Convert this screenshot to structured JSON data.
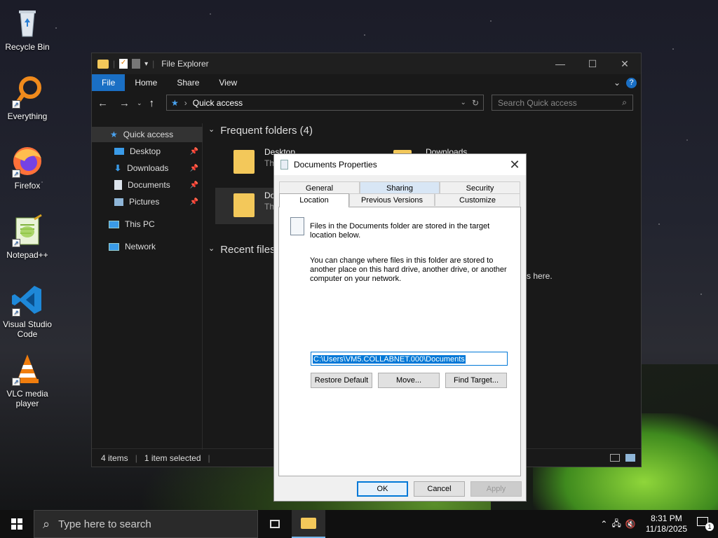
{
  "desktop": {
    "icons": [
      {
        "label": "Recycle Bin",
        "icon": "recycle-bin-icon"
      },
      {
        "label": "Everything",
        "icon": "everything-search-icon"
      },
      {
        "label": "Firefox",
        "icon": "firefox-icon"
      },
      {
        "label": "Notepad++",
        "icon": "notepad-plus-plus-icon"
      },
      {
        "label": "Visual Studio Code",
        "icon": "vscode-icon"
      },
      {
        "label": "VLC media player",
        "icon": "vlc-icon"
      }
    ]
  },
  "explorer": {
    "title": "File Explorer",
    "ribbon_tabs": [
      "File",
      "Home",
      "Share",
      "View"
    ],
    "address": "Quick access",
    "search_placeholder": "Search Quick access",
    "nav": [
      {
        "label": "Quick access",
        "pinned": false
      },
      {
        "label": "Desktop",
        "pinned": true
      },
      {
        "label": "Downloads",
        "pinned": true
      },
      {
        "label": "Documents",
        "pinned": true
      },
      {
        "label": "Pictures",
        "pinned": true
      },
      {
        "label": "This PC",
        "pinned": false
      },
      {
        "label": "Network",
        "pinned": false
      }
    ],
    "frequent_header": "Frequent folders (4)",
    "frequent": [
      {
        "name": "Desktop",
        "sub": "Th"
      },
      {
        "name": "Downloads",
        "sub": ""
      },
      {
        "name": "Do",
        "sub": "Th"
      }
    ],
    "recent_header": "Recent files",
    "recent_hint_fragment": "s here.",
    "status_items": "4 items",
    "status_selected": "1 item selected"
  },
  "dialog": {
    "title": "Documents Properties",
    "tabs_row1": [
      "General",
      "Sharing",
      "Security"
    ],
    "tabs_row2": [
      "Location",
      "Previous Versions",
      "Customize"
    ],
    "info_text": "Files in the Documents folder are stored in the target location below.",
    "help_text": "You can change where files in this folder are stored to another place on this hard drive, another drive, or another computer on your network.",
    "path": "C:\\Users\\VM5.COLLABNET.000\\Documents",
    "restore_default": "Restore Default",
    "move": "Move...",
    "find_target": "Find Target...",
    "ok": "OK",
    "cancel": "Cancel",
    "apply": "Apply"
  },
  "taskbar": {
    "search_placeholder": "Type here to search",
    "time": "8:31 PM",
    "date": "11/18/2025",
    "notification_count": "1"
  }
}
